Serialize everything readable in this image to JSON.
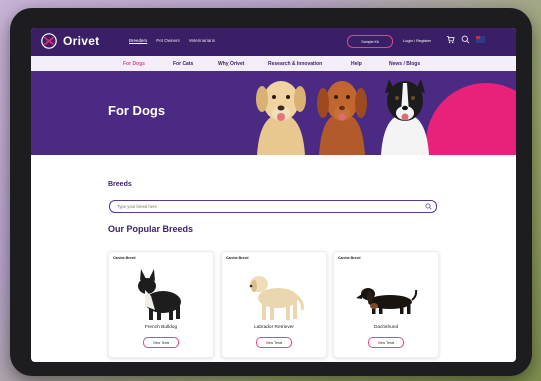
{
  "header": {
    "brand": "Orivet",
    "nav": [
      "Breeders",
      "Pet Owners",
      "Veterinarians"
    ],
    "sample_button": "Sample Kit",
    "login": "Login / Register"
  },
  "main_nav": [
    "For Dogs",
    "For Cats",
    "Why Orivet",
    "Research & Innovation",
    "Help",
    "News / Blogs"
  ],
  "hero": {
    "title": "For Dogs"
  },
  "breeds": {
    "label": "Breeds",
    "search_placeholder": "Type your breed here"
  },
  "popular": {
    "title": "Our Popular Breeds",
    "cards": [
      {
        "tag": "Canine Breed",
        "name": "French Bulldog",
        "button": "View Tests"
      },
      {
        "tag": "Canine Breed",
        "name": "Labrador Retriever",
        "button": "View Tests"
      },
      {
        "tag": "Canine Breed",
        "name": "Dachshund",
        "button": "View Tests"
      }
    ]
  },
  "colors": {
    "brand_purple": "#3a1f66",
    "hero_purple": "#4a2a83",
    "accent_pink": "#d64a8f",
    "hero_blob": "#e8217a"
  },
  "icons": [
    "logo-mark-icon",
    "cart-icon",
    "search-icon",
    "flag-icon"
  ]
}
